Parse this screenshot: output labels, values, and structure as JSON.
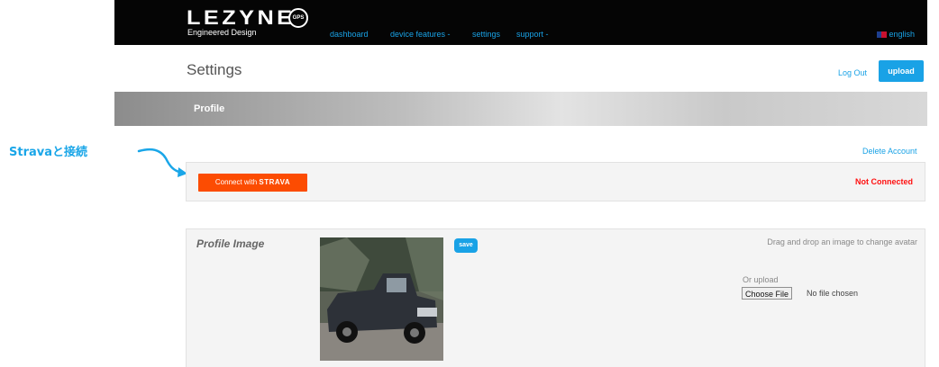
{
  "annotation": {
    "label": "Stravaと接続"
  },
  "nav": {
    "logo": "LEZYNE",
    "tagline": "Engineered Design",
    "gps_badge": "GPS",
    "links": [
      "dashboard",
      "device features -",
      "settings",
      "support -"
    ],
    "language": "english"
  },
  "header": {
    "title": "Settings",
    "logout_label": "Log Out",
    "upload_label": "upload"
  },
  "profile_banner": {
    "label": "Profile"
  },
  "account": {
    "delete_label": "Delete Account"
  },
  "strava": {
    "button_prefix": "Connect with",
    "button_brand": "STRAVA",
    "status": "Not Connected",
    "brand_color": "#fc4c02",
    "status_color": "#ff1010"
  },
  "profile_image": {
    "title": "Profile Image",
    "save_label": "save",
    "drag_text": "Drag and drop an image to change avatar",
    "or_upload": "Or upload",
    "choose_file": "Choose File",
    "no_file": "No file chosen"
  },
  "colors": {
    "accent": "#19a2e6",
    "nav_bg": "#050505"
  }
}
